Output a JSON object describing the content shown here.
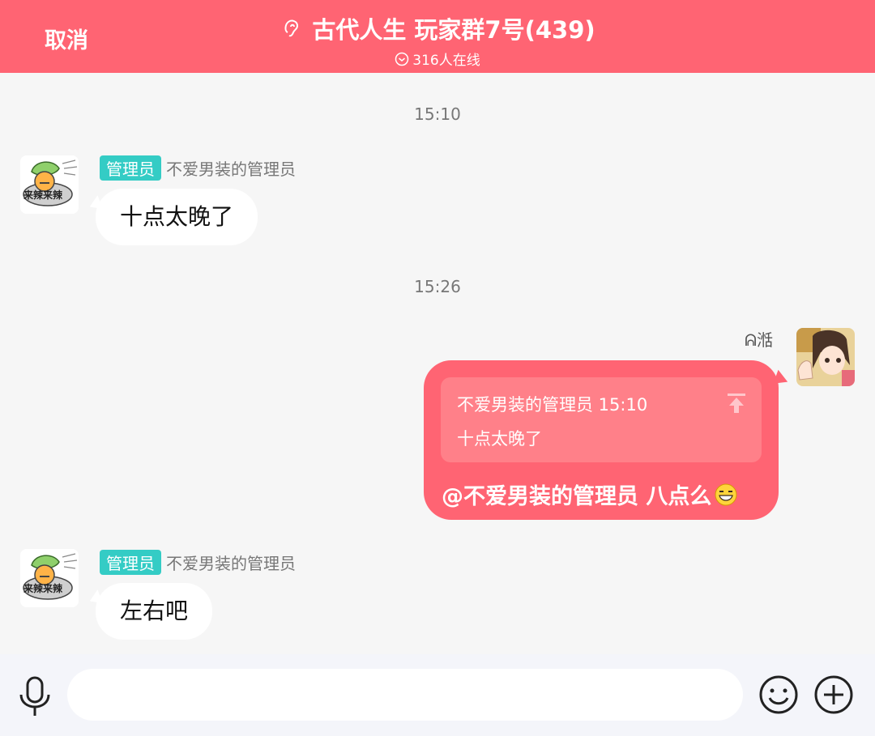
{
  "header": {
    "cancel_label": "取消",
    "title": "古代人生 玩家群7号(439)",
    "online": "316人在线",
    "ear_icon": "ear-icon",
    "online_icon": "check-circle-icon",
    "background_color": "#ff6473"
  },
  "messages": [
    {
      "time": "15:10"
    },
    {
      "sender_badge": "管理员",
      "sender_name": "不爱男装的管理员",
      "text": "十点太晚了",
      "avatar_icon": "leaf-bowl-sticker-avatar",
      "avatar_caption": "来辣来辣"
    },
    {
      "time": "15:26"
    },
    {
      "sender_name": "ᕱ湉",
      "quote": {
        "header": "不爱男装的管理员 15:10",
        "text": "十点太晚了",
        "icon": "jump-to-top-icon"
      },
      "text": "@不爱男装的管理员 八点么",
      "emoji": "grin-emoji",
      "avatar_icon": "anime-girl-avatar"
    },
    {
      "sender_badge": "管理员",
      "sender_name": "不爱男装的管理员",
      "text": "左右吧",
      "avatar_icon": "leaf-bowl-sticker-avatar",
      "avatar_caption": "来辣来辣"
    }
  ],
  "input_bar": {
    "placeholder": "",
    "mic_icon": "microphone-icon",
    "emoji_icon": "smile-icon",
    "plus_icon": "plus-icon"
  },
  "colors": {
    "accent": "#ff6473",
    "badge": "#34ccc5",
    "bubble_mine": "#ff6473",
    "bubble_quote": "#ff8089"
  }
}
